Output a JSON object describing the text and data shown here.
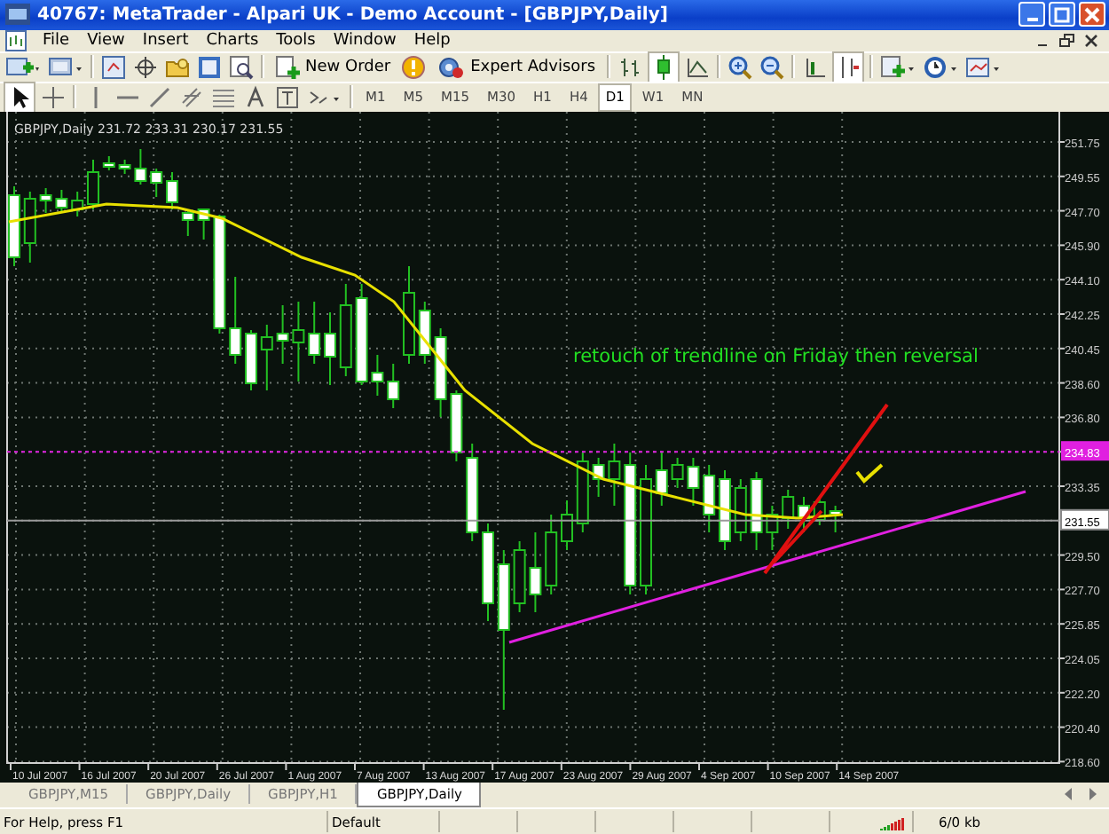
{
  "window": {
    "title": "40767: MetaTrader - Alpari UK - Demo Account - [GBPJPY,Daily]"
  },
  "menu": [
    "File",
    "View",
    "Insert",
    "Charts",
    "Tools",
    "Window",
    "Help"
  ],
  "toolbar": {
    "buttons": [
      "New Order",
      "Expert Advisors"
    ]
  },
  "timeframes": [
    {
      "label": "M1",
      "selected": false
    },
    {
      "label": "M5",
      "selected": false
    },
    {
      "label": "M15",
      "selected": false
    },
    {
      "label": "M30",
      "selected": false
    },
    {
      "label": "H1",
      "selected": false
    },
    {
      "label": "H4",
      "selected": false
    },
    {
      "label": "D1",
      "selected": true
    },
    {
      "label": "W1",
      "selected": false
    },
    {
      "label": "MN",
      "selected": false
    }
  ],
  "chart": {
    "info": "GBPJPY,Daily  231.72 233.31 230.17 231.55",
    "note": "retouch of trendline on Friday then reversal",
    "price_labels": [
      {
        "text": "251.75",
        "kind": "grid"
      },
      {
        "text": "249.55",
        "kind": "grid"
      },
      {
        "text": "247.70",
        "kind": "grid"
      },
      {
        "text": "245.90",
        "kind": "grid"
      },
      {
        "text": "244.10",
        "kind": "grid"
      },
      {
        "text": "242.25",
        "kind": "grid"
      },
      {
        "text": "240.45",
        "kind": "grid"
      },
      {
        "text": "238.60",
        "kind": "grid"
      },
      {
        "text": "236.80",
        "kind": "grid"
      },
      {
        "text": "234.83",
        "kind": "line"
      },
      {
        "text": "233.35",
        "kind": "grid"
      },
      {
        "text": "231.55",
        "kind": "bid"
      },
      {
        "text": "229.50",
        "kind": "grid"
      },
      {
        "text": "227.70",
        "kind": "grid"
      },
      {
        "text": "225.85",
        "kind": "grid"
      },
      {
        "text": "224.05",
        "kind": "grid"
      },
      {
        "text": "222.20",
        "kind": "grid"
      },
      {
        "text": "220.40",
        "kind": "grid"
      },
      {
        "text": "218.60",
        "kind": "grid"
      }
    ],
    "date_labels": [
      "10 Jul 2007",
      "16 Jul 2007",
      "20 Jul 2007",
      "26 Jul 2007",
      "1 Aug 2007",
      "7 Aug 2007",
      "13 Aug 2007",
      "17 Aug 2007",
      "23 Aug 2007",
      "29 Aug 2007",
      "4 Sep 2007",
      "10 Sep 2007",
      "14 Sep 2007"
    ]
  },
  "tabs": [
    {
      "label": "GBPJPY,M15",
      "selected": false
    },
    {
      "label": "GBPJPY,Daily",
      "selected": false
    },
    {
      "label": "GBPJPY,H1",
      "selected": false
    },
    {
      "label": "GBPJPY,Daily",
      "selected": true
    }
  ],
  "status_bar": [
    "For Help, press F1",
    "Default",
    "6/0 kb"
  ]
}
